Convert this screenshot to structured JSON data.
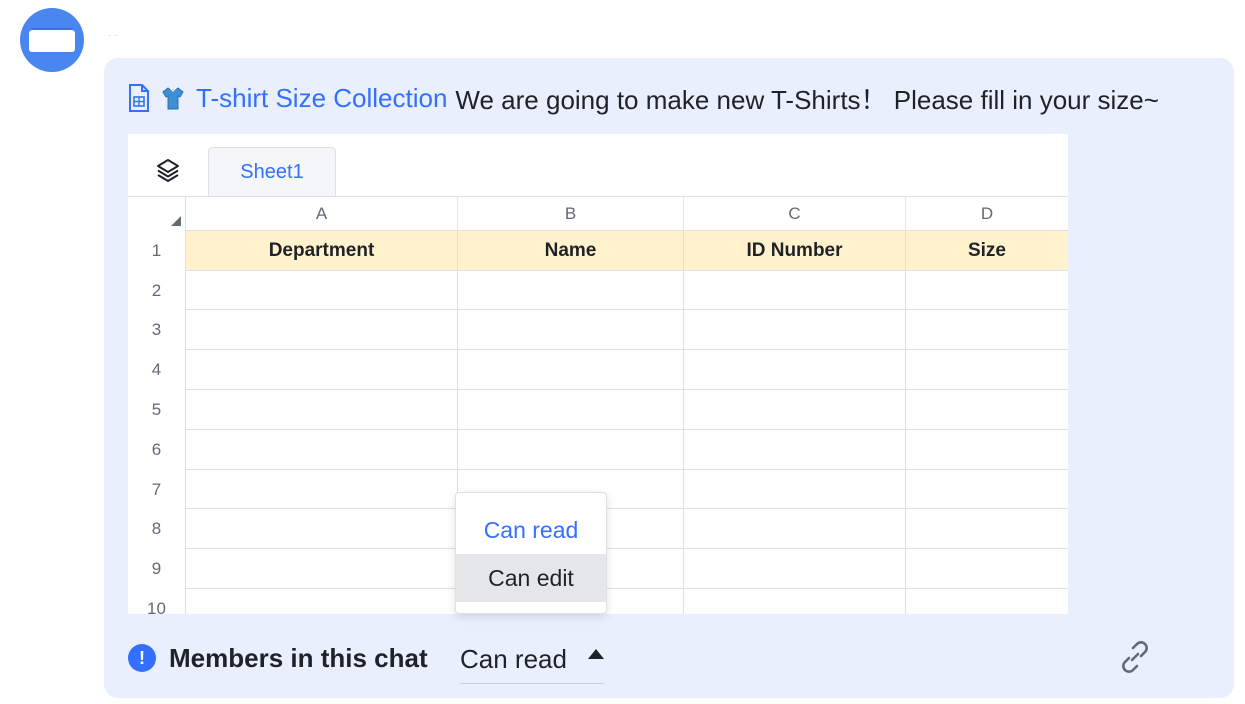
{
  "message": {
    "doc_emoji": "👕",
    "doc_title": "T-shirt Size Collection",
    "text": "We are going to make new T-Shirts！ Please fill in your size~"
  },
  "sheet": {
    "tab_label": "Sheet1",
    "columns": [
      "A",
      "B",
      "C",
      "D"
    ],
    "header_row": [
      "Department",
      "Name",
      "ID Number",
      "Size"
    ],
    "row_numbers": [
      "1",
      "2",
      "3",
      "4",
      "5",
      "6",
      "7",
      "8",
      "9",
      "10"
    ]
  },
  "permission_dropdown": {
    "options": [
      "Can read",
      "Can edit"
    ]
  },
  "footer": {
    "label": "Members in this chat",
    "permission_value": "Can read"
  },
  "colors": {
    "accent": "#3370ff",
    "bubble_bg": "#e9effc",
    "header_fill": "#fff2cc",
    "avatar": "#4a86f0"
  },
  "icons": [
    "sheet-doc-icon",
    "tshirt-icon",
    "layers-icon",
    "info-icon",
    "caret-up-icon",
    "link-icon"
  ]
}
